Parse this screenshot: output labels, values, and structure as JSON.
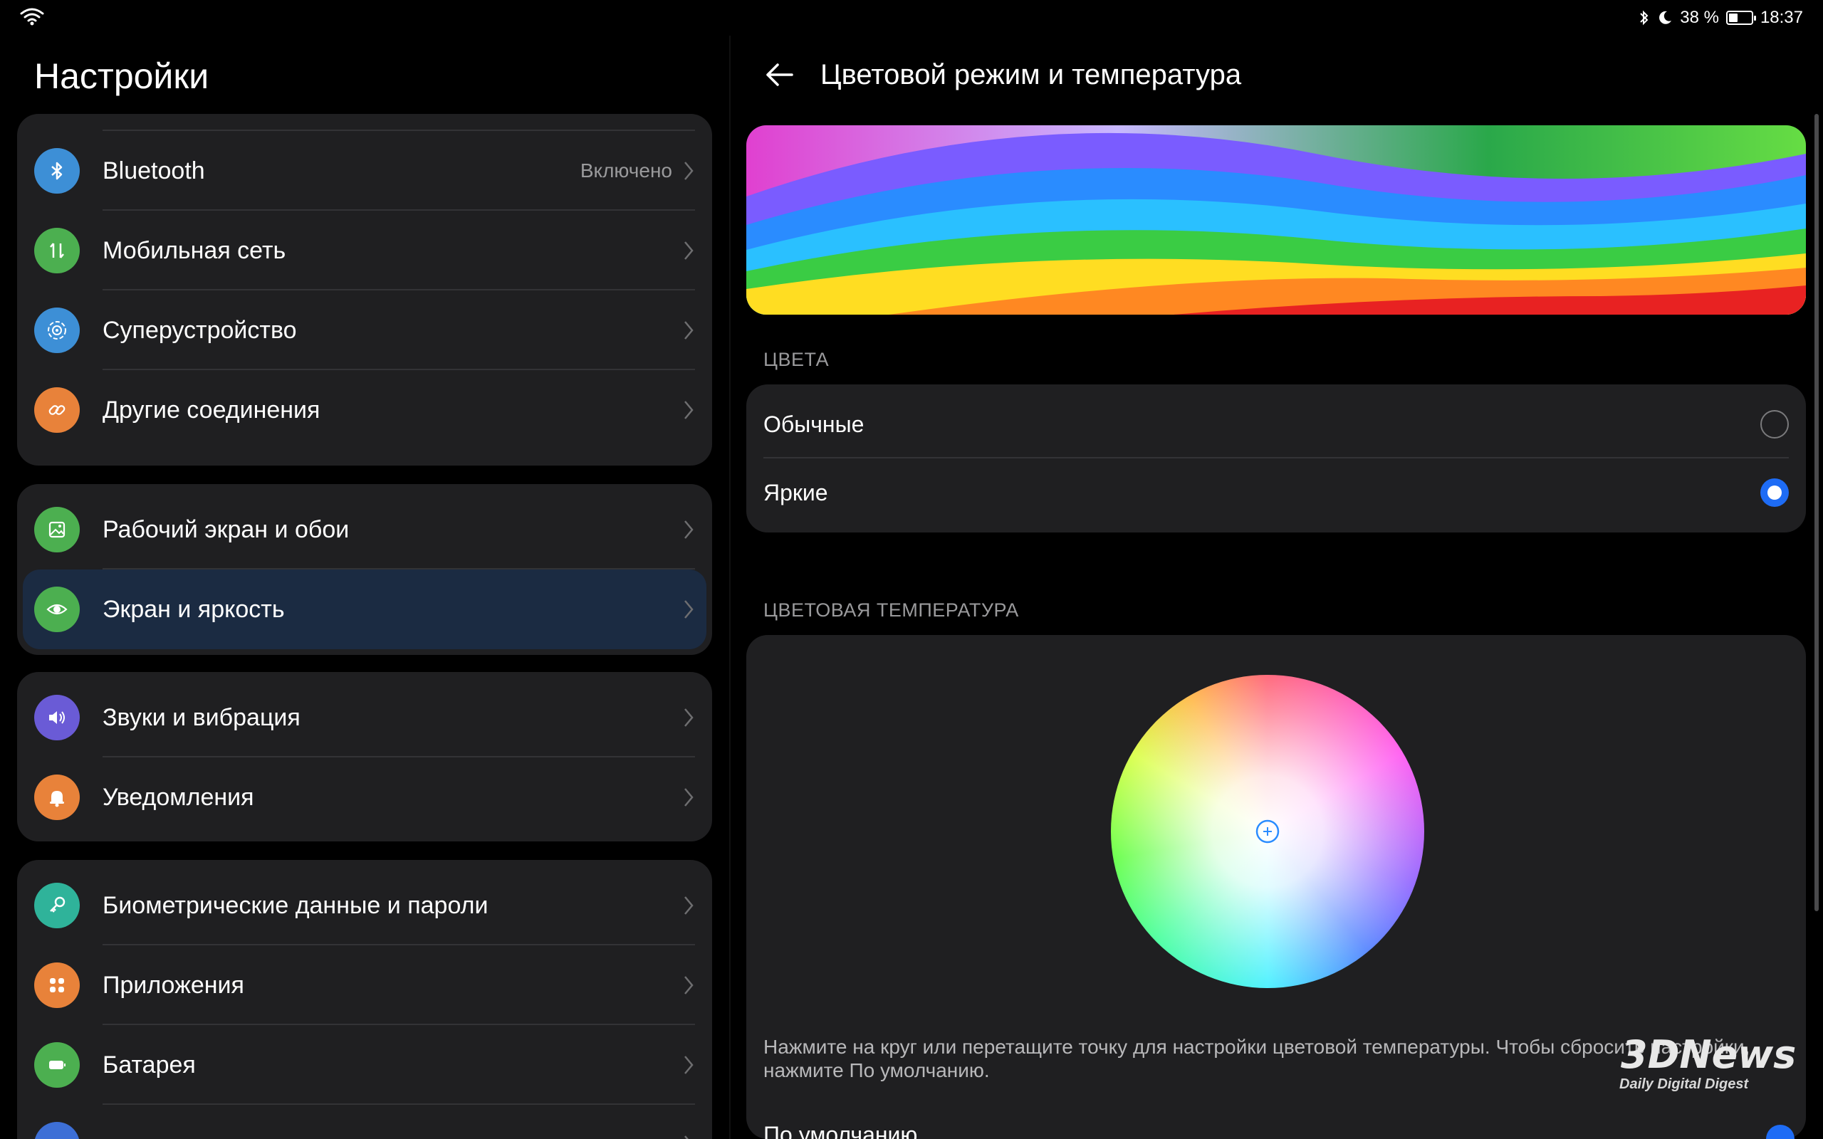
{
  "status_bar": {
    "battery_percent": "38 %",
    "time": "18:37",
    "battery_level": 0.38
  },
  "left": {
    "title": "Настройки",
    "groups": [
      {
        "items": [
          {
            "label": "Bluetooth",
            "value": "Включено",
            "icon": "bluetooth-icon",
            "color": "#3d8fd6"
          },
          {
            "label": "Мобильная сеть",
            "icon": "mobile-data-icon",
            "color": "#4caf50"
          },
          {
            "label": "Суперустройство",
            "icon": "super-device-icon",
            "color": "#3d8fd6"
          },
          {
            "label": "Другие соединения",
            "icon": "link-icon",
            "color": "#e8823a"
          }
        ]
      },
      {
        "items": [
          {
            "label": "Рабочий экран и обои",
            "icon": "wallpaper-icon",
            "color": "#4caf50"
          },
          {
            "label": "Экран и яркость",
            "icon": "eye-icon",
            "color": "#4caf50",
            "active": true
          }
        ]
      },
      {
        "items": [
          {
            "label": "Звуки и вибрация",
            "icon": "sound-icon",
            "color": "#6a5bd6"
          },
          {
            "label": "Уведомления",
            "icon": "bell-icon",
            "color": "#e8823a"
          }
        ]
      },
      {
        "items": [
          {
            "label": "Биометрические данные и пароли",
            "icon": "key-icon",
            "color": "#2fb39a"
          },
          {
            "label": "Приложения",
            "icon": "apps-icon",
            "color": "#e8823a"
          },
          {
            "label": "Батарея",
            "icon": "battery-icon",
            "color": "#4caf50"
          }
        ]
      }
    ]
  },
  "right": {
    "title": "Цветовой режим и температура",
    "colors_section": "ЦВЕТА",
    "color_options": [
      {
        "label": "Обычные",
        "selected": false
      },
      {
        "label": "Яркие",
        "selected": true
      }
    ],
    "temperature_section": "ЦВЕТОВАЯ ТЕМПЕРАТУРА",
    "hint": "Нажмите на круг или перетащите точку для настройки цветовой температуры. Чтобы сбросить настройки, нажмите По умолчанию.",
    "default_label": "По умолчанию"
  },
  "watermark": {
    "logo": "3DNews",
    "tagline": "Daily Digital Digest"
  },
  "colors": {
    "accent": "#1e6cf5",
    "card": "#1f1f21",
    "active_row": "#1b2b42"
  }
}
